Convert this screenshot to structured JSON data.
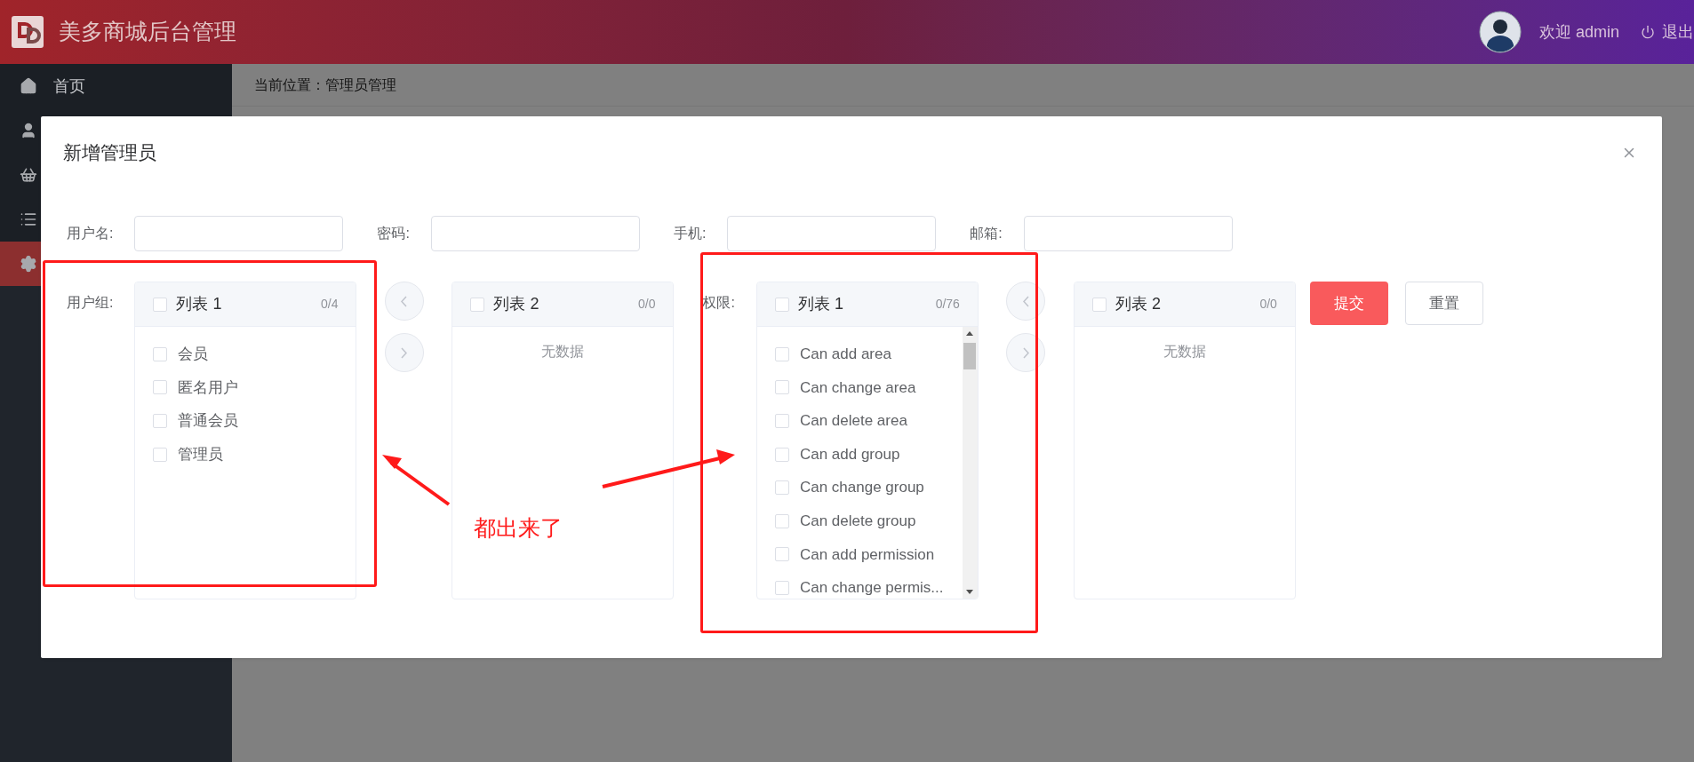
{
  "header": {
    "title": "美多商城后台管理",
    "welcome": "欢迎 admin",
    "logout": "退出"
  },
  "sidebar": {
    "items": [
      {
        "kind": "home",
        "label": "首页",
        "selected": false
      },
      {
        "kind": "user",
        "selected": false
      },
      {
        "kind": "basket",
        "selected": false
      },
      {
        "kind": "list",
        "selected": false
      },
      {
        "kind": "gear",
        "selected": true
      }
    ]
  },
  "breadcrumb": "当前位置：管理员管理",
  "dialog": {
    "title": "新增管理员",
    "fields": [
      {
        "label": "用户名:"
      },
      {
        "label": "密码:"
      },
      {
        "label": "手机:"
      },
      {
        "label": "邮箱:"
      }
    ],
    "transfers": [
      {
        "label": "用户组:",
        "source": {
          "title": "列表 1",
          "count": "0/4",
          "checked": false,
          "scroll": false,
          "items": [
            {
              "label": "会员",
              "checked": false
            },
            {
              "label": "匿名用户",
              "checked": false
            },
            {
              "label": "普通会员",
              "checked": false
            },
            {
              "label": "管理员",
              "checked": false
            }
          ]
        },
        "target": {
          "title": "列表 2",
          "count": "0/0",
          "checked": false,
          "empty": "无数据"
        }
      },
      {
        "label": "权限:",
        "source": {
          "title": "列表 1",
          "count": "0/76",
          "checked": false,
          "scroll": true,
          "items": [
            {
              "label": "Can add area",
              "checked": false
            },
            {
              "label": "Can change area",
              "checked": false
            },
            {
              "label": "Can delete area",
              "checked": false
            },
            {
              "label": "Can add group",
              "checked": false
            },
            {
              "label": "Can change group",
              "checked": false
            },
            {
              "label": "Can delete group",
              "checked": false
            },
            {
              "label": "Can add permission",
              "checked": false
            },
            {
              "label": "Can change permis...",
              "checked": false
            }
          ]
        },
        "target": {
          "title": "列表 2",
          "count": "0/0",
          "checked": false,
          "empty": "无数据"
        }
      }
    ],
    "buttons": [
      {
        "label": "提交",
        "kind": "primary"
      },
      {
        "label": "重置",
        "kind": "default"
      }
    ]
  },
  "annotation": {
    "text": "都出来了"
  }
}
